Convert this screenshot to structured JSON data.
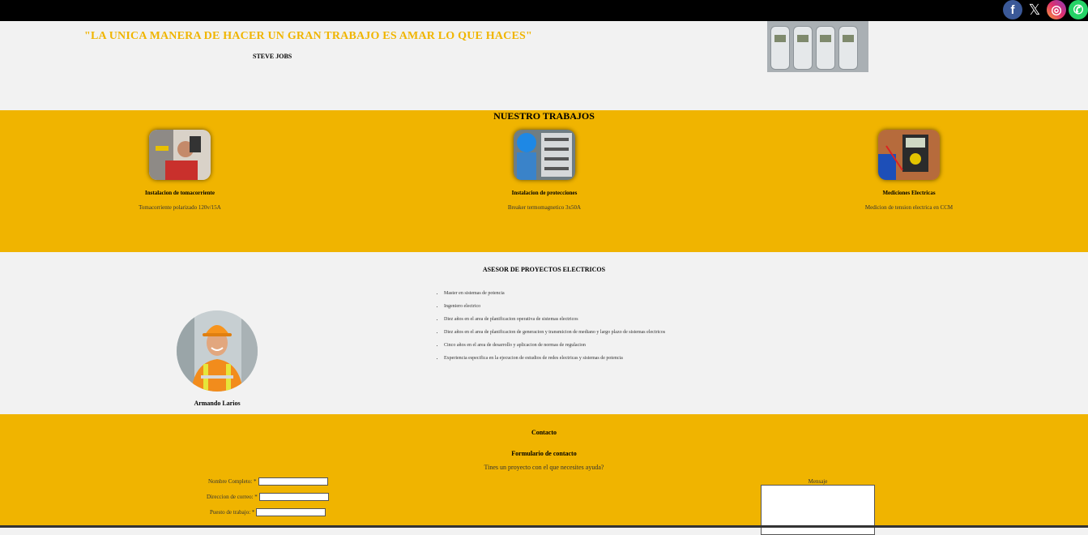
{
  "social": {
    "facebook": {
      "icon": "facebook-icon",
      "glyph": "f"
    },
    "x": {
      "icon": "x-icon",
      "glyph": "𝕏"
    },
    "instagram": {
      "icon": "instagram-icon",
      "glyph": "◎"
    },
    "whatsapp": {
      "icon": "whatsapp-icon",
      "glyph": "✆"
    }
  },
  "hero": {
    "quote": "\"LA UNICA MANERA DE HACER UN GRAN TRABAJO ES AMAR LO QUE HACES\"",
    "author": "STEVE JOBS"
  },
  "works": {
    "title": "NUESTRO TRABAJOS",
    "items": [
      {
        "title": "Instalacion de tomacorriente",
        "desc": "Tomacorriente polarizado 120v/15A"
      },
      {
        "title": "Instalacion de protecciones",
        "desc": "Breaker termomagnetico 3x50A"
      },
      {
        "title": "Mediciones Electricas",
        "desc": "Medicion de tension electrica en CCM"
      }
    ]
  },
  "advisor": {
    "title": "ASESOR DE PROYECTOS ELECTRICOS",
    "name": "Armando Larios",
    "qualifications": [
      "Master en sistemas de potencia",
      "Ingeniero electrico",
      "Diez años en el area de planificacion operativa de sistemas electricos",
      "Diez años en el area de planificacion de generacion y transmicion de mediano y largo plazo de sistemas electricos",
      "Cinco años en el area de desarrollo y aplicacion de normas de regulacion",
      "Experiencia especifica en la ejecucion de estudios de redes electricas y sistemas de potencia"
    ]
  },
  "contact": {
    "title": "Contacto",
    "form_title": "Formulario de contacto",
    "question": "Tines un proyecto con el que necesites ayuda?",
    "fields": {
      "name_label": "Nombre Completo: *",
      "email_label": "Direccion de correo: *",
      "job_label": "Puesto de trabajo: *"
    },
    "message_label": "Mensaje"
  },
  "colors": {
    "accent": "#f0b400",
    "topbar": "#000000",
    "background": "#f2f2f2"
  }
}
